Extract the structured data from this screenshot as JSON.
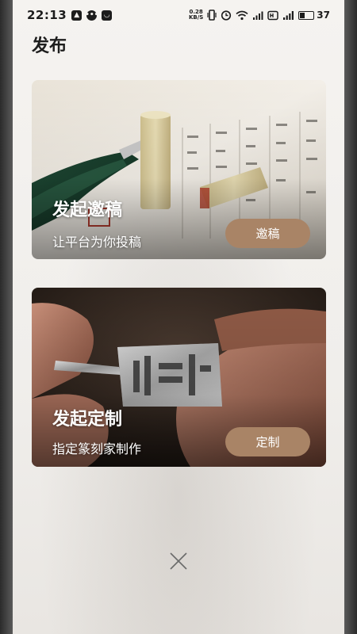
{
  "status_bar": {
    "time": "22:13",
    "net_speed_value": "0.28",
    "net_speed_unit": "KB/S",
    "battery_level": "37"
  },
  "page": {
    "title": "发布"
  },
  "cards": [
    {
      "title": "发起邀稿",
      "subtitle": "让平台为你投稿",
      "button_label": "邀稿"
    },
    {
      "title": "发起定制",
      "subtitle": "指定篆刻家制作",
      "button_label": "定制"
    }
  ],
  "colors": {
    "button_bg": "#a98466",
    "page_bg": "#f2f0ed"
  },
  "icons": {
    "close": "close-icon"
  }
}
